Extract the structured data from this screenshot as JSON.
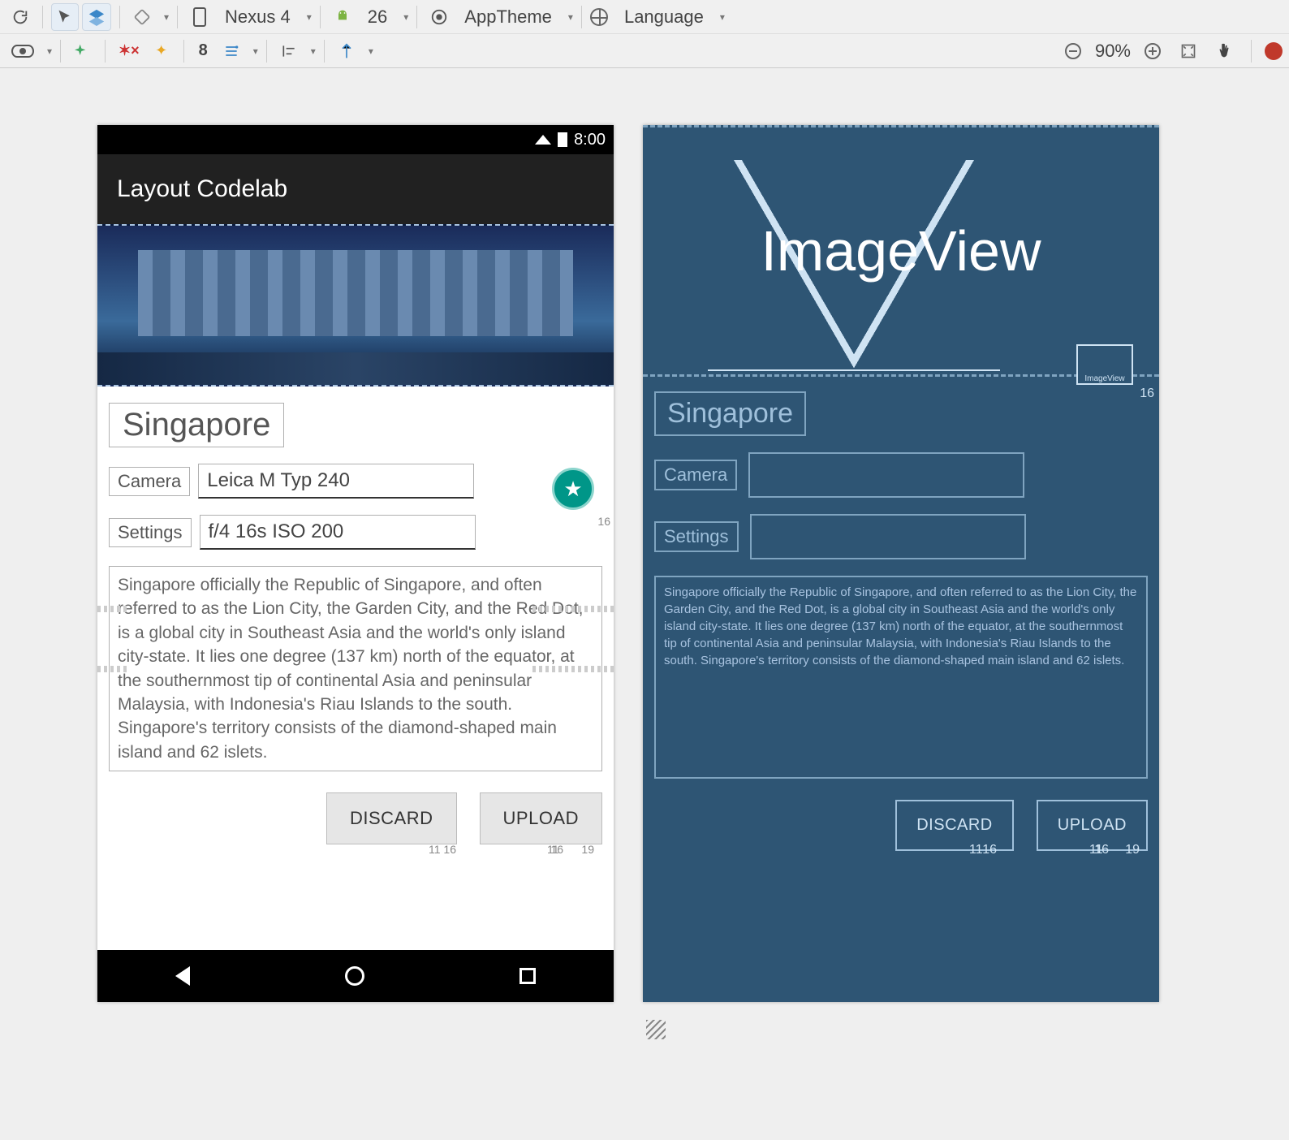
{
  "toolbar1": {
    "device": "Nexus 4",
    "api": "26",
    "theme": "AppTheme",
    "language": "Language"
  },
  "toolbar2": {
    "grid_value": "8",
    "zoom": "90%"
  },
  "design": {
    "status_time": "8:00",
    "appbar_title": "Layout Codelab",
    "title": "Singapore",
    "camera_label": "Camera",
    "camera_value": "Leica M Typ 240",
    "settings_label": "Settings",
    "settings_value": "f/4 16s ISO 200",
    "description": "Singapore officially the Republic of Singapore, and often referred to as the Lion City, the Garden City, and the Red Dot, is a global city in Southeast Asia and the world's only island city-state. It lies one degree (137 km) north of the equator, at the southernmost tip of continental Asia and peninsular Malaysia, with Indonesia's Riau Islands to the south. Singapore's territory consists of the diamond-shaped main island and 62 islets.",
    "discard_label": "DISCARD",
    "upload_label": "UPLOAD",
    "margin16a": "16",
    "margin16b": "16",
    "margin16c": "16",
    "margin11a": "11",
    "margin11b": "11",
    "margin19": "19"
  },
  "blueprint": {
    "image_text": "ImageView",
    "thumb_label": "ImageView",
    "title": "Singapore",
    "camera_label": "Camera",
    "settings_label": "Settings",
    "description": "Singapore officially the Republic of Singapore, and often referred to as the Lion City, the Garden City, and the Red Dot, is a global city in Southeast Asia and the world's only island city-state. It lies one degree (137 km) north of the equator, at the southernmost tip of continental Asia and peninsular Malaysia, with Indonesia's Riau Islands to the south. Singapore's territory consists of the diamond-shaped main island and 62 islets.",
    "discard_label": "DISCARD",
    "upload_label": "UPLOAD",
    "margin16a": "16",
    "margin16b": "16",
    "margin16c": "16",
    "margin11a": "11",
    "margin11b": "11",
    "margin19": "19"
  }
}
